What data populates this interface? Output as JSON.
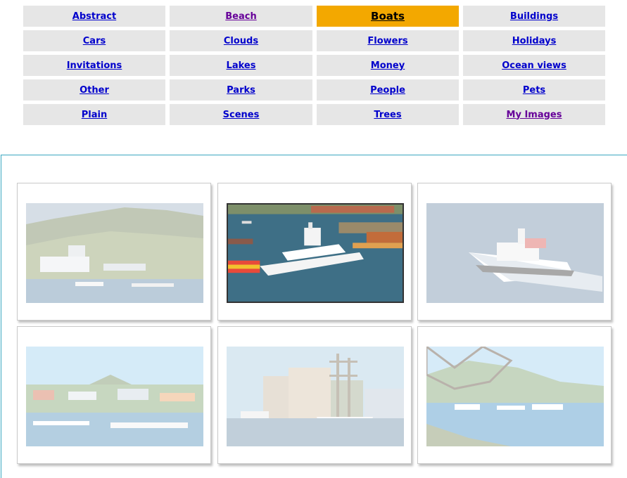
{
  "categories": [
    {
      "label": "Abstract",
      "state": "link"
    },
    {
      "label": "Beach",
      "state": "visited"
    },
    {
      "label": "Boats",
      "state": "active"
    },
    {
      "label": "Buildings",
      "state": "link"
    },
    {
      "label": "Cars",
      "state": "link"
    },
    {
      "label": "Clouds",
      "state": "link"
    },
    {
      "label": "Flowers",
      "state": "link"
    },
    {
      "label": "Holidays",
      "state": "link"
    },
    {
      "label": "Invitations",
      "state": "link"
    },
    {
      "label": "Lakes",
      "state": "link"
    },
    {
      "label": "Money",
      "state": "link"
    },
    {
      "label": "Ocean views",
      "state": "link"
    },
    {
      "label": "Other",
      "state": "link"
    },
    {
      "label": "Parks",
      "state": "link"
    },
    {
      "label": "People",
      "state": "link"
    },
    {
      "label": "Pets",
      "state": "link"
    },
    {
      "label": "Plain",
      "state": "link"
    },
    {
      "label": "Scenes",
      "state": "link"
    },
    {
      "label": "Trees",
      "state": "link"
    },
    {
      "label": "My Images",
      "state": "visited"
    }
  ],
  "colors": {
    "active_tab": "#f3a800",
    "tab_background": "#e6e6e6",
    "link": "#0000cc",
    "visited_link": "#660099",
    "panel_border": "#3aa7c0"
  },
  "gallery": [
    {
      "scene": "hillside-harbor",
      "selected": false
    },
    {
      "scene": "superyacht-dock",
      "selected": true
    },
    {
      "scene": "pilot-boat",
      "selected": false
    },
    {
      "scene": "island-marina",
      "selected": false
    },
    {
      "scene": "tall-ship-hotel",
      "selected": false
    },
    {
      "scene": "bay-through-trees",
      "selected": false
    }
  ]
}
